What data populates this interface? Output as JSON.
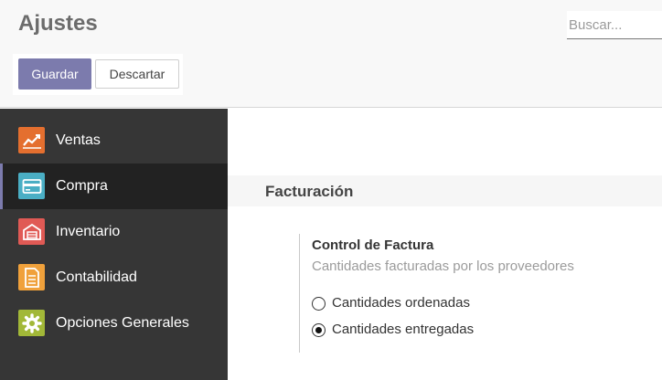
{
  "header": {
    "title": "Ajustes",
    "search_placeholder": "Buscar...",
    "save_label": "Guardar",
    "discard_label": "Descartar"
  },
  "sidebar": {
    "items": [
      {
        "label": "Ventas",
        "icon": "chart-line-icon",
        "color": "#e46f2f",
        "active": false
      },
      {
        "label": "Compra",
        "icon": "credit-card-icon",
        "color": "#4aaec4",
        "active": true
      },
      {
        "label": "Inventario",
        "icon": "warehouse-icon",
        "color": "#e05a55",
        "active": false
      },
      {
        "label": "Contabilidad",
        "icon": "invoice-icon",
        "color": "#f0a13b",
        "active": false
      },
      {
        "label": "Opciones Generales",
        "icon": "gear-icon",
        "color": "#a2b838",
        "active": false
      }
    ]
  },
  "main": {
    "section_title": "Facturación",
    "setting": {
      "title": "Control de Factura",
      "description": "Cantidades facturadas por los proveedores",
      "options": [
        {
          "label": "Cantidades ordenadas",
          "selected": false
        },
        {
          "label": "Cantidades entregadas",
          "selected": true
        }
      ]
    }
  },
  "colors": {
    "accent": "#7c7bad",
    "sidebar_bg": "#363636",
    "sidebar_active_bg": "#222222"
  }
}
